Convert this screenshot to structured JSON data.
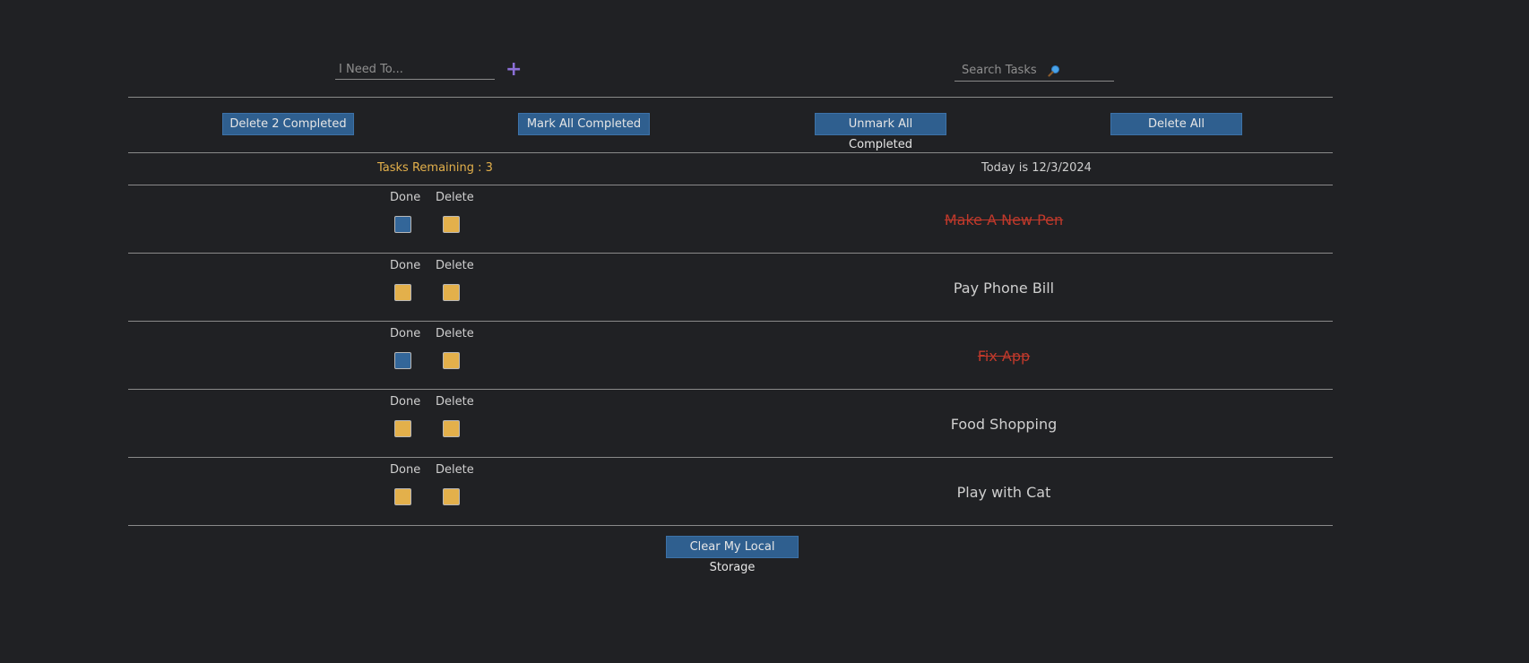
{
  "add": {
    "placeholder": "I Need To..."
  },
  "search": {
    "placeholder": "Search Tasks"
  },
  "actions": {
    "delete_completed": "Delete 2 Completed",
    "mark_all": "Mark All Completed",
    "unmark_all": "Unmark All Completed",
    "delete_all": "Delete All"
  },
  "status": {
    "remaining": "Tasks Remaining : 3",
    "today": "Today is 12/3/2024"
  },
  "columns": {
    "done": "Done",
    "delete": "Delete"
  },
  "tasks": [
    {
      "text": "Make A New Pen",
      "completed": true
    },
    {
      "text": "Pay Phone Bill",
      "completed": false
    },
    {
      "text": "Fix App",
      "completed": true
    },
    {
      "text": "Food Shopping",
      "completed": false
    },
    {
      "text": "Play with Cat",
      "completed": false
    }
  ],
  "footer": {
    "clear_storage": "Clear My Local Storage"
  },
  "colors": {
    "accent_gold": "#e3b04b",
    "button_blue": "#2f5f8f",
    "completed_red": "#c0392b",
    "plus_purple": "#8b6fd6"
  }
}
